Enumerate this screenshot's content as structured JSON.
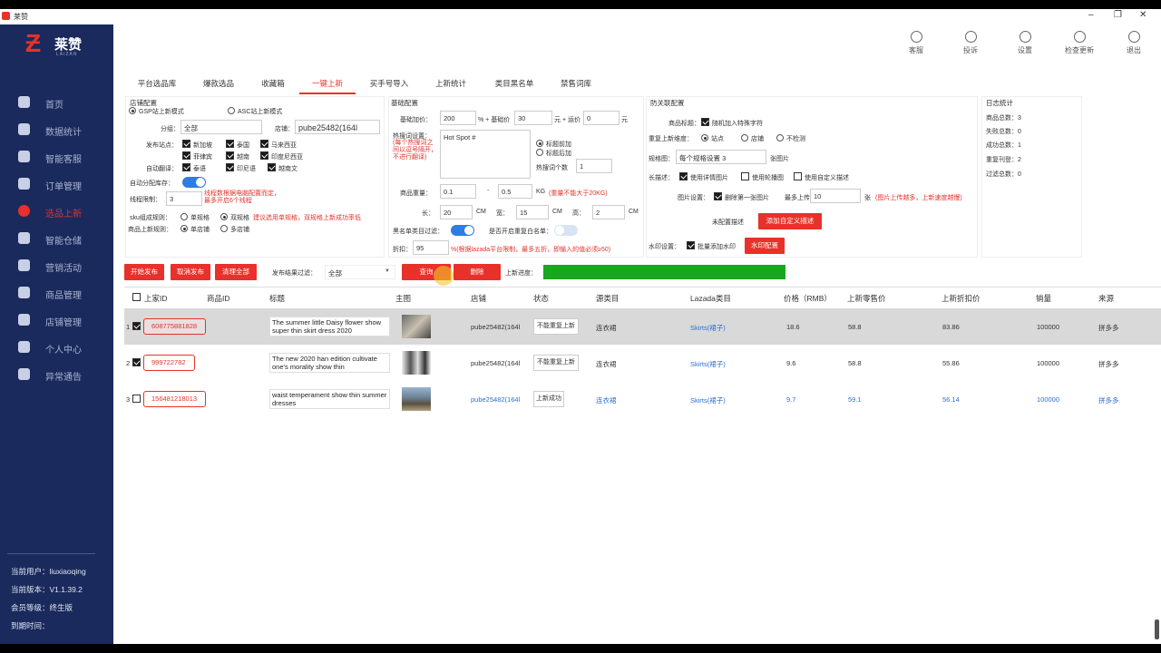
{
  "window": {
    "title": "莱赞",
    "minimize": "‒",
    "restore": "❐",
    "close": "✕"
  },
  "logo": {
    "text": "莱赞",
    "sub": "LAIZAN"
  },
  "sidebar": {
    "items": [
      {
        "label": "首页",
        "icon": "home-icon"
      },
      {
        "label": "数据统计",
        "icon": "chart-icon"
      },
      {
        "label": "智能客服",
        "icon": "chat-icon"
      },
      {
        "label": "订单管理",
        "icon": "order-icon"
      },
      {
        "label": "选品上新",
        "icon": "product-icon"
      },
      {
        "label": "智能仓储",
        "icon": "warehouse-icon"
      },
      {
        "label": "营销活动",
        "icon": "campaign-icon"
      },
      {
        "label": "商品管理",
        "icon": "goods-icon"
      },
      {
        "label": "店铺管理",
        "icon": "shop-icon"
      },
      {
        "label": "个人中心",
        "icon": "user-icon"
      },
      {
        "label": "异常通告",
        "icon": "warning-icon"
      }
    ],
    "user": "当前用户：liuxiaoqing",
    "version": "当前版本：V1.1.39.2",
    "level": "会员等级：终生版",
    "expire": "到期时间："
  },
  "toolbar": [
    {
      "label": "客服",
      "icon": "support-icon"
    },
    {
      "label": "投诉",
      "icon": "complaint-icon"
    },
    {
      "label": "设置",
      "icon": "settings-icon"
    },
    {
      "label": "检查更新",
      "icon": "update-icon"
    },
    {
      "label": "退出",
      "icon": "power-icon"
    }
  ],
  "tabs": [
    "平台选品库",
    "爆款选品",
    "收藏箱",
    "一键上新",
    "买手号导入",
    "上新统计",
    "类目黑名单",
    "禁售词库"
  ],
  "shop": {
    "title": "店铺配置",
    "mode1": "GSP站上新模式",
    "mode2": "ASC站上新模式",
    "group_label": "分组：",
    "group_value": "全部",
    "shop_label": "店铺：",
    "shop_value": "pube25482(164l",
    "sites_label": "发布站点：",
    "sites": [
      "新加坡",
      "泰国",
      "马来西亚",
      "菲律宾",
      "越南",
      "印度尼西亚"
    ],
    "translate_label": "自动翻译：",
    "translate": [
      "泰语",
      "印尼语",
      "越南文"
    ],
    "auto_stock": "自动分配库存：",
    "threads_label": "线程限制：",
    "threads_value": "3",
    "threads_hint": "线程数根据电脑配置而定，最多开启6个线程",
    "sku_label": "sku组成规则：",
    "sku_single": "单规格",
    "sku_double": "双规格",
    "sku_hint": "建议选用单规格，双规格上新成功率低",
    "rule_label": "商品上新规则：",
    "rule_single": "单店铺",
    "rule_multi": "多店铺"
  },
  "basic": {
    "title": "基础配置",
    "price_label": "基础加价：",
    "price_value": "200",
    "price_unit": "% + 基础价",
    "base_value": "30",
    "base_unit": "元 + 运价",
    "ship_value": "0",
    "ship_unit": "元",
    "hot_label": "热搜词设置：",
    "hot_hint": "(每个热搜词之间以逗号隔开，不进行翻译)",
    "hot_value": "Hot Spot #",
    "pos1": "标题前加",
    "pos2": "标题后加",
    "hot_count_label": "热搜词个数",
    "hot_count_value": "1",
    "weight_label": "商品重量：",
    "weight_min": "0.1",
    "weight_dash": "-",
    "weight_max": "0.5",
    "weight_unit": "KG",
    "weight_hint": "(重量不能大于20KG)",
    "len_label": "长：",
    "len_value": "20",
    "wid_label": "宽：",
    "wid_value": "15",
    "hei_label": "高：",
    "hei_value": "2",
    "cm": "CM",
    "blacklist_label": "黑名单类目过滤：",
    "fba_label": "是否开启重复白名单：",
    "discount_label": "折扣：",
    "discount_value": "95",
    "discount_hint": "%(根据lazada平台限制，最多五折，即输入的值必须≥50)"
  },
  "anti": {
    "title": "防关联配置",
    "title_label": "商品标题：",
    "title_opt": "随机加入特殊字符",
    "repeat_label": "重复上新维度：",
    "repeat_site": "站点",
    "repeat_shop": "店铺",
    "repeat_none": "不检测",
    "spec_label": "规格图：",
    "spec_value": "每个规格设置 3",
    "spec_unit": "张图片",
    "desc_label": "长描述：",
    "desc_opt1": "使用详情图片",
    "desc_opt2": "使用轮播图",
    "desc_opt3": "使用自定义描述",
    "img_label": "图片设置：",
    "img_opt": "删除第一张图片",
    "img_max_label": "最多上传",
    "img_max_value": "10",
    "img_unit": "张",
    "img_hint": "(图片上传越多，上新速度越慢)",
    "custom_label": "未配置描述",
    "custom_btn": "添加自定义描述",
    "watermark_label": "水印设置：",
    "watermark_opt": "批量添加水印",
    "watermark_btn": "水印配置"
  },
  "log": {
    "title": "日志统计",
    "total": "商品总数：3",
    "fail": "失败总数：0",
    "success": "成功总数：1",
    "repeat": "重复刊登：2",
    "filter": "过滤总数：0"
  },
  "actions": {
    "start": "开始发布",
    "cancel": "取消发布",
    "clear": "清理全部",
    "filter_label": "发布结果过滤：",
    "filter_value": "全部",
    "query": "查询",
    "delete": "删除",
    "progress_label": "上新进度："
  },
  "progress": 1.0,
  "table": {
    "headers": [
      "上家ID",
      "商品ID",
      "标题",
      "主图",
      "店铺",
      "状态",
      "源类目",
      "Lazada类目",
      "价格（RMB）",
      "上新零售价",
      "上新折扣价",
      "销量",
      "来源"
    ],
    "rows": [
      {
        "num": "1",
        "checked": true,
        "id": "608775881828",
        "title": "The summer little Daisy flower show super thin skirt dress 2020",
        "shop": "pube25482(164l",
        "status": "不能重复上新",
        "src_cat": "连衣裙",
        "laz_cat": "Skirts(裙子)",
        "price": "18.6",
        "retail": "58.8",
        "disc": "83.86",
        "sales": "100000",
        "source": "拼多多"
      },
      {
        "num": "2",
        "checked": true,
        "id": "999722782",
        "title": "The new 2020 han edition cultivate one's morality show thin",
        "shop": "pube25482(164l",
        "status": "不能重复上新",
        "src_cat": "连衣裙",
        "laz_cat": "Skirts(裙子)",
        "price": "9.6",
        "retail": "58.8",
        "disc": "55.86",
        "sales": "100000",
        "source": "拼多多"
      },
      {
        "num": "3",
        "checked": false,
        "id": "156481218013",
        "title": "waist temperament show thin summer dresses",
        "shop": "pube25482(164l",
        "status": "上新成功",
        "src_cat": "连衣裙",
        "laz_cat": "Skirts(裙子)",
        "price": "9.7",
        "retail": "59.1",
        "disc": "56.14",
        "sales": "100000",
        "source": "拼多多"
      }
    ]
  },
  "colors": {
    "accent": "#e8312a",
    "sidebar": "#1a2a5c",
    "progress": "#18a81e",
    "toggle": "#2e7de0"
  }
}
